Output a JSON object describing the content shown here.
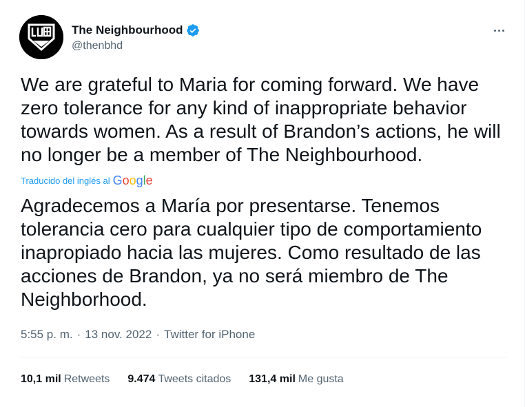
{
  "author": {
    "display_name": "The Neighbourhood",
    "handle": "@thenbhd",
    "verified": true
  },
  "tweet": {
    "text": "We are grateful to Maria for coming forward. We have zero tolerance for any kind of inappropriate behavior towards women. As a result of Brandon’s actions, he will no longer be a member of The Neighbourhood.",
    "translated_label": "Traducido del inglés al",
    "translator_brand": "Google",
    "translation": "Agradecemos a María por presentarse. Tenemos tolerancia cero para cualquier tipo de comportamiento inapropiado hacia las mujeres. Como resultado de las acciones de Brandon, ya no será miembro de The Neighborhood."
  },
  "meta": {
    "time": "5:55 p. m.",
    "separator": "·",
    "date": "13 nov. 2022",
    "source": "Twitter for iPhone"
  },
  "stats": {
    "retweets_count": "10,1 mil",
    "retweets_label": "Retweets",
    "quotes_count": "9.474",
    "quotes_label": "Tweets citados",
    "likes_count": "131,4 mil",
    "likes_label": "Me gusta"
  },
  "colors": {
    "text": "#0f1419",
    "secondary": "#536471",
    "link": "#1d9bf0",
    "verified": "#1d9bf0"
  },
  "icons": {
    "verified": "verified-badge-icon",
    "more": "more-options-icon",
    "avatar_logo": "band-logo"
  }
}
